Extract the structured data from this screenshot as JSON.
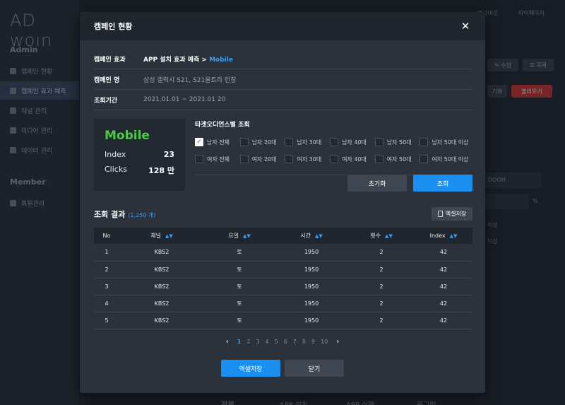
{
  "app": {
    "logo": "AD woın",
    "top_links": [
      "로그아웃",
      "마이페이지"
    ]
  },
  "sidebar": {
    "admin_label": "Admin",
    "admin_items": [
      {
        "label": "캠페인 현황",
        "icon": "chart-icon"
      },
      {
        "label": "캠페인 효과 예측",
        "icon": "bulb-icon"
      },
      {
        "label": "채널 관리",
        "icon": "users-icon"
      },
      {
        "label": "미디어 관리",
        "icon": "video-icon"
      },
      {
        "label": "데이터 관리",
        "icon": "database-icon"
      }
    ],
    "member_label": "Member",
    "member_items": [
      {
        "label": "회원관리",
        "icon": "members-icon"
      }
    ]
  },
  "background": {
    "edit_label": "수정",
    "list_label": "목록",
    "btn_a": "기화",
    "btn_b": "불러오기",
    "dooh": "DOOH",
    "pct": "%",
    "above1": "이상",
    "above2": "이상",
    "tabs": [
      "전체",
      "APP 설치",
      "APP 실행",
      "로그인"
    ]
  },
  "modal": {
    "title": "캠페인 현황",
    "info": {
      "effect_label": "캠페인 효과",
      "effect_prefix": "APP 설치 효과 예측 >",
      "effect_link": "Mobile",
      "name_label": "캠페인 명",
      "name_value": "삼성 갤럭시 S21, S21울트라 런칭",
      "period_label": "조회기간",
      "period_value": "2021.01.01 ~ 2021.01 20"
    },
    "stats": {
      "title": "Mobile",
      "index_label": "Index",
      "index_value": "23",
      "clicks_label": "Clicks",
      "clicks_value": "128 만"
    },
    "audience": {
      "title": "타겟오디언스별 조회",
      "rows": [
        [
          {
            "label": "남자 전체",
            "checked": true
          },
          {
            "label": "남자 20대",
            "checked": false
          },
          {
            "label": "남자 30대",
            "checked": false
          },
          {
            "label": "남자 40대",
            "checked": false
          },
          {
            "label": "남자 50대",
            "checked": false
          },
          {
            "label": "남자 50대 이상",
            "checked": false
          }
        ],
        [
          {
            "label": "여자 전체",
            "checked": false
          },
          {
            "label": "여자 20대",
            "checked": false
          },
          {
            "label": "여자 30대",
            "checked": false
          },
          {
            "label": "여자 40대",
            "checked": false
          },
          {
            "label": "여자 50대",
            "checked": false
          },
          {
            "label": "여자 50대 이상",
            "checked": false
          }
        ]
      ],
      "reset_label": "초기화",
      "search_label": "조회"
    },
    "results": {
      "title": "조회 결과",
      "count": "(1,250 개)",
      "excel_small_label": "엑셀저장",
      "columns": [
        "No",
        "채널",
        "요일",
        "시간",
        "횟수",
        "Index"
      ],
      "rows": [
        [
          "1",
          "KBS2",
          "토",
          "1950",
          "2",
          "42"
        ],
        [
          "2",
          "KBS2",
          "토",
          "1950",
          "2",
          "42"
        ],
        [
          "3",
          "KBS2",
          "토",
          "1950",
          "2",
          "42"
        ],
        [
          "4",
          "KBS2",
          "토",
          "1950",
          "2",
          "42"
        ],
        [
          "5",
          "KBS2",
          "토",
          "1950",
          "2",
          "42"
        ]
      ]
    },
    "pagination": {
      "pages": [
        "1",
        "2",
        "3",
        "4",
        "5",
        "6",
        "7",
        "8",
        "9",
        "10"
      ],
      "current": "1"
    },
    "footer": {
      "excel_label": "엑셀저장",
      "close_label": "닫기"
    }
  },
  "colors": {
    "accent": "#1a8ff0",
    "link": "#3e9cf0",
    "mobile_green": "#4ec94a",
    "modal_bg": "#2b323c"
  }
}
